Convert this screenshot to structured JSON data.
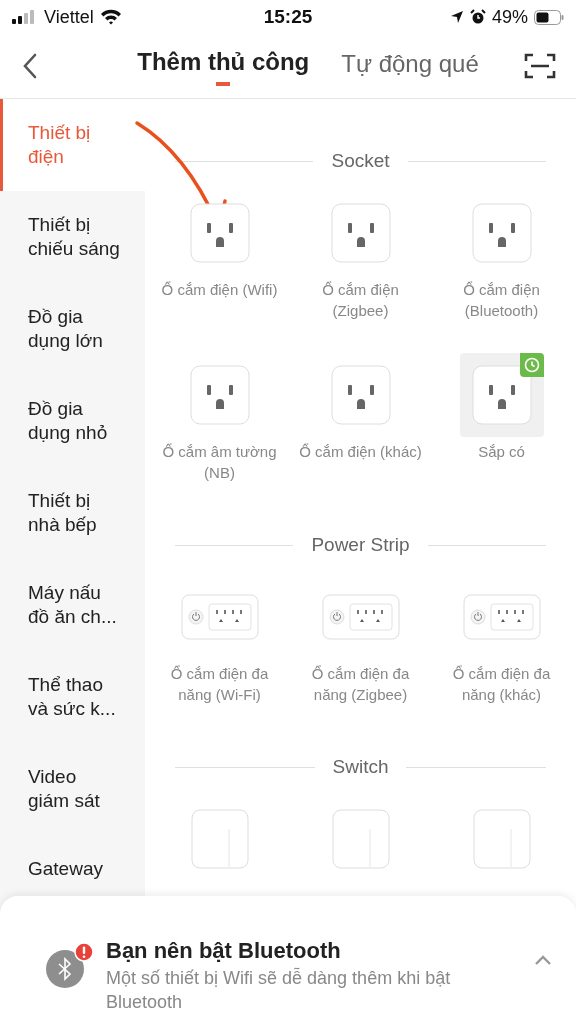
{
  "status_bar": {
    "carrier": "Viettel",
    "time": "15:25",
    "battery": "49%"
  },
  "tabs": [
    {
      "label": "Thêm thủ công",
      "selected": true
    },
    {
      "label": "Tự động qué",
      "selected": false
    }
  ],
  "sidebar": {
    "items": [
      {
        "label": "Thiết bị điện",
        "selected": true
      },
      {
        "label": "Thiết bị chiếu sáng",
        "selected": false
      },
      {
        "label": "Đồ gia dụng lớn",
        "selected": false
      },
      {
        "label": "Đồ gia dụng nhỏ",
        "selected": false
      },
      {
        "label": "Thiết bị nhà bếp",
        "selected": false
      },
      {
        "label": "Máy nấu đồ ăn ch...",
        "selected": false
      },
      {
        "label": "Thể thao và sức k...",
        "selected": false
      },
      {
        "label": "Video giám sát",
        "selected": false
      },
      {
        "label": "Gateway",
        "selected": false
      }
    ]
  },
  "sections": [
    {
      "title": "Socket",
      "items": [
        {
          "kind": "socket",
          "label": "Ổ cắm điện (Wifi)",
          "coming_soon": false
        },
        {
          "kind": "socket",
          "label": "Ổ cắm điện (Zigbee)",
          "coming_soon": false
        },
        {
          "kind": "socket",
          "label": "Ổ cắm điện (Bluetooth)",
          "coming_soon": false
        },
        {
          "kind": "socket",
          "label": "Ổ cắm âm tường (NB)",
          "coming_soon": false
        },
        {
          "kind": "socket",
          "label": "Ổ cắm điện (khác)",
          "coming_soon": false
        },
        {
          "kind": "socket",
          "label": "Sắp có",
          "coming_soon": true
        }
      ]
    },
    {
      "title": "Power Strip",
      "items": [
        {
          "kind": "strip",
          "label": "Ổ cắm điện đa năng (Wi-Fi)",
          "coming_soon": false
        },
        {
          "kind": "strip",
          "label": "Ổ cắm điện đa năng (Zigbee)",
          "coming_soon": false
        },
        {
          "kind": "strip",
          "label": "Ổ cắm điện đa năng (khác)",
          "coming_soon": false
        }
      ]
    },
    {
      "title": "Switch",
      "items": [
        {
          "kind": "switch"
        },
        {
          "kind": "switch"
        },
        {
          "kind": "switch"
        }
      ]
    }
  ],
  "banner": {
    "title": "Bạn nên bật Bluetooth",
    "message": "Một số thiết bị Wifi sẽ dễ dàng thêm khi bật Bluetooth"
  }
}
